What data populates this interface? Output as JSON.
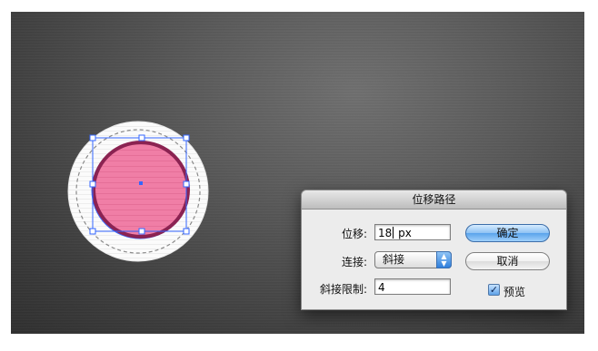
{
  "dialog": {
    "title": "位移路径",
    "offset": {
      "label": "位移:",
      "value_before_cursor": "18",
      "value_after_cursor": " px"
    },
    "joins": {
      "label": "连接:",
      "selected": "斜接"
    },
    "miter_limit": {
      "label": "斜接限制:",
      "value": "4"
    },
    "ok_label": "确定",
    "cancel_label": "取消",
    "preview": {
      "label": "预览",
      "checked": true
    }
  },
  "icons": {
    "select_arrows": "up-down-arrows-icon",
    "checkmark": "checkmark-icon"
  },
  "colors": {
    "canvas_bg": "#4a4a4a",
    "badge_fill": "#ffffff",
    "inner_fill": "#f07ea6",
    "inner_stroke": "#8b2352",
    "selection": "#3366ff"
  }
}
